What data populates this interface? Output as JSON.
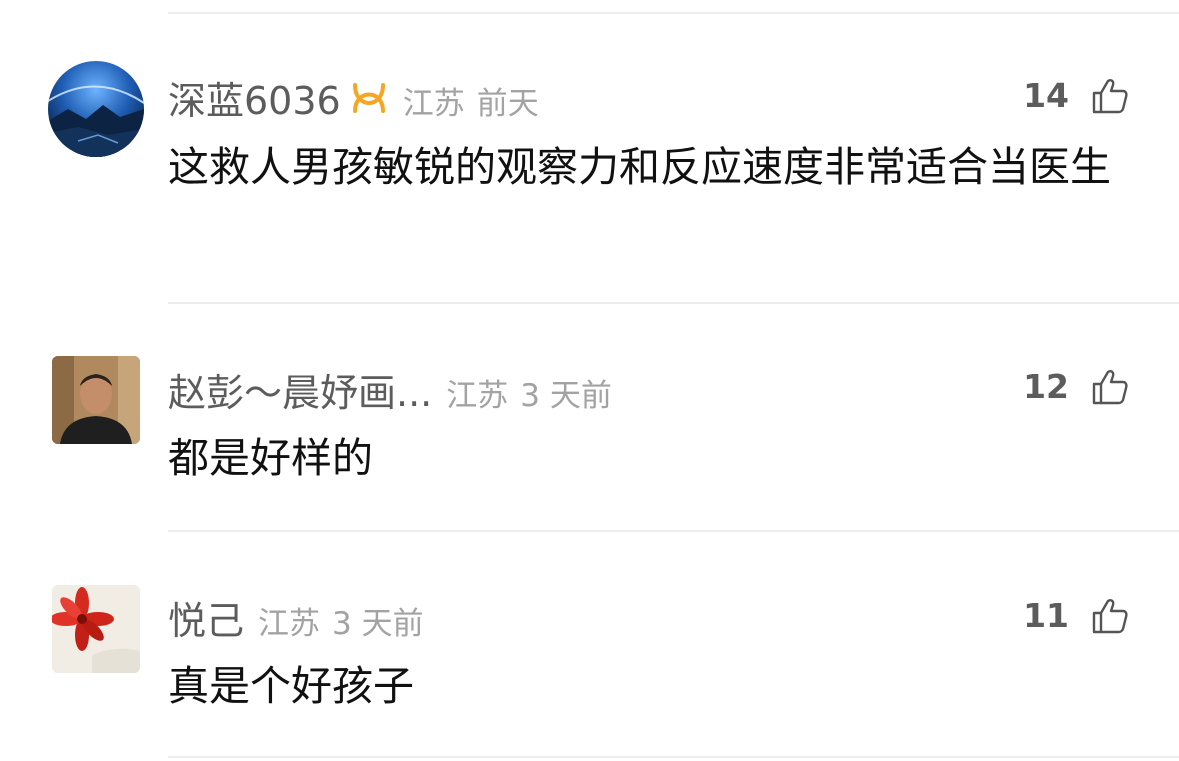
{
  "comments": [
    {
      "username": "深蓝6036",
      "has_badge": true,
      "badge_icon": "vip-infinity-badge",
      "badge_color": "#f5a623",
      "location": "江苏",
      "time": "前天",
      "likes": "14",
      "content": "这救人男孩敏锐的观察力和反应速度非常适合当医生",
      "avatar": "night-sky-landscape"
    },
    {
      "username": "赵彭～晨妤画...",
      "has_badge": false,
      "location": "江苏",
      "time": "3 天前",
      "likes": "12",
      "content": "都是好样的",
      "avatar": "man-portrait-photo"
    },
    {
      "username": "悦己",
      "has_badge": false,
      "location": "江苏",
      "time": "3 天前",
      "likes": "11",
      "content": "真是个好孩子",
      "avatar": "red-flower-photo"
    }
  ],
  "icons": {
    "like": "thumbs-up-outline-icon"
  },
  "colors": {
    "username": "#5c5c5c",
    "meta": "#a3a3a3",
    "content": "#111111",
    "divider": "#ececec"
  }
}
